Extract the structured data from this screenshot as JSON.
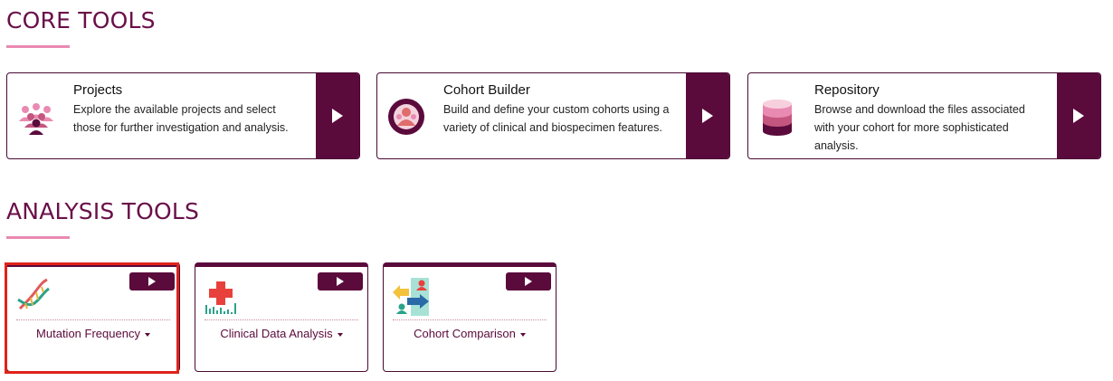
{
  "core_section": {
    "title": "CORE TOOLS"
  },
  "analysis_section": {
    "title": "ANALYSIS TOOLS"
  },
  "core_tools": [
    {
      "title": "Projects",
      "description": "Explore the available projects and select those for further investigation and analysis.",
      "icon": "people-group-icon"
    },
    {
      "title": "Cohort Builder",
      "description": "Build and define your custom cohorts using a variety of clinical and biospecimen features.",
      "icon": "cohort-icon"
    },
    {
      "title": "Repository",
      "description": "Browse and download the files associated with your cohort for more sophisticated analysis.",
      "icon": "database-icon"
    }
  ],
  "analysis_tools": [
    {
      "label": "Mutation Frequency",
      "icon": "dna-icon",
      "selected": true
    },
    {
      "label": "Clinical Data Analysis",
      "icon": "medical-chart-icon",
      "selected": false
    },
    {
      "label": "Cohort Comparison",
      "icon": "compare-icon",
      "selected": false
    }
  ],
  "colors": {
    "brand": "#5b0a3c",
    "title": "#6a0f49",
    "accent_underline": "#e98ab2",
    "highlight": "#e0221b"
  }
}
